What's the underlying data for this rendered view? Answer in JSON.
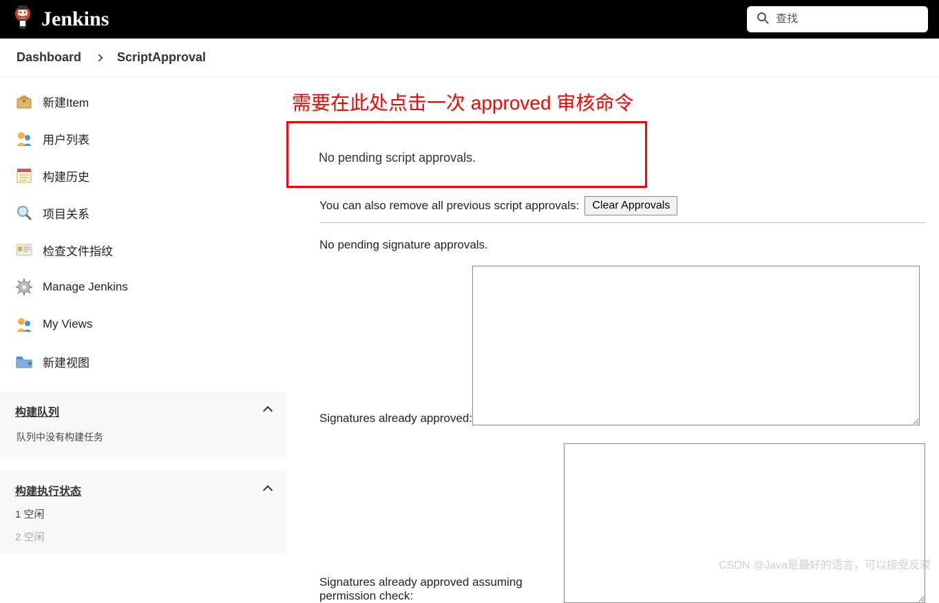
{
  "header": {
    "brand": "Jenkins",
    "search_placeholder": "查找"
  },
  "breadcrumbs": {
    "dashboard": "Dashboard",
    "page": "ScriptApproval"
  },
  "sidebar": {
    "items": [
      {
        "label": "新建Item"
      },
      {
        "label": "用户列表"
      },
      {
        "label": "构建历史"
      },
      {
        "label": "项目关系"
      },
      {
        "label": "检查文件指纹"
      },
      {
        "label": "Manage Jenkins"
      },
      {
        "label": "My Views"
      },
      {
        "label": "新建视图"
      }
    ],
    "queue": {
      "title": "构建队列",
      "empty": "队列中没有构建任务"
    },
    "exec": {
      "title": "构建执行状态",
      "items": [
        "1  空闲",
        "2  空闲"
      ]
    }
  },
  "main": {
    "annotation": "需要在此处点击一次 approved 审核命令",
    "no_pending_scripts": "No pending script approvals.",
    "remove_previous": "You can also remove all previous script approvals:",
    "clear_btn": "Clear Approvals",
    "no_pending_sigs": "No pending signature approvals.",
    "sig_approved": "Signatures already approved:",
    "sig_approved_perm": "Signatures already approved assuming permission check:",
    "ta1": "",
    "ta2": ""
  },
  "watermark": "CSDN @Java是最好的语言，可以接受反驳"
}
